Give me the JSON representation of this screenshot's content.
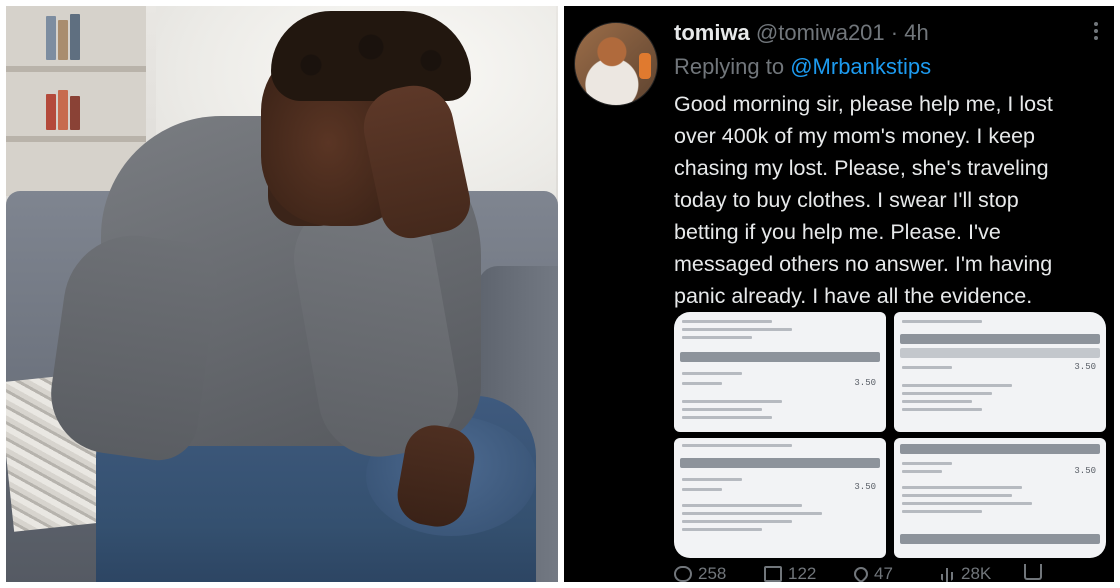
{
  "tweet": {
    "display_name": "tomiwa",
    "handle": "@tomiwa201",
    "separator": "·",
    "time": "4h",
    "replying_prefix": "Replying to",
    "replying_to": "@Mrbankstips",
    "body_lines": [
      "Good morning sir, please help me, I lost",
      "over 400k of my mom's money. I keep",
      "chasing my lost. Please, she's traveling",
      "today to buy clothes. I swear I'll stop",
      "betting if you help me.  Please. I've",
      "messaged others no answer. I'm having",
      "panic already. I have all the evidence."
    ],
    "media_values": [
      "3.50",
      "3.50",
      "3.50",
      "3.50"
    ],
    "actions": {
      "replies": "258",
      "retweets": "122",
      "likes": "47",
      "views": "28K"
    }
  },
  "colors": {
    "tweet_background": "#000000",
    "primary_text": "#e7e9ea",
    "secondary_text": "#71767b",
    "link_blue": "#1d9bf0"
  },
  "icons": [
    "more-icon",
    "reply-icon",
    "retweet-icon",
    "like-icon",
    "views-icon",
    "share-icon"
  ]
}
